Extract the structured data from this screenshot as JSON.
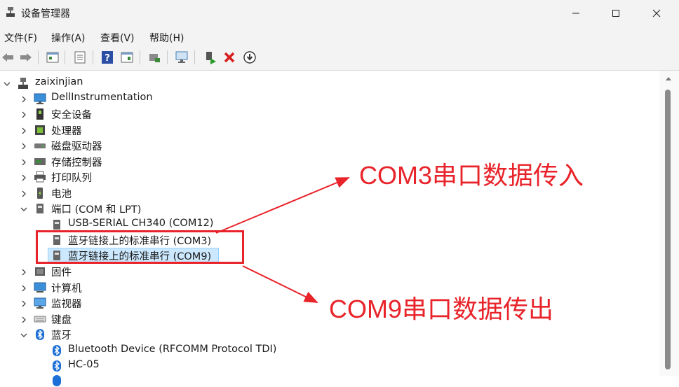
{
  "window": {
    "title": "设备管理器",
    "icon": "device-manager-icon"
  },
  "menu": [
    "文件(F)",
    "操作(A)",
    "查看(V)",
    "帮助(H)"
  ],
  "toolbar": {
    "buttons": [
      "back-arrow-icon",
      "forward-arrow-icon",
      "properties-icon",
      "details-icon",
      "help-icon",
      "view-icon",
      "update-driver-icon",
      "scan-hardware-icon",
      "enable-device-icon",
      "uninstall-icon",
      "download-icon"
    ]
  },
  "tree": {
    "root": "zaixinjian",
    "items": [
      {
        "label": "DellInstrumentation",
        "icon": "monitor-icon",
        "expanded": false
      },
      {
        "label": "安全设备",
        "icon": "security-device-icon",
        "expanded": false
      },
      {
        "label": "处理器",
        "icon": "processor-icon",
        "expanded": false
      },
      {
        "label": "磁盘驱动器",
        "icon": "disk-drive-icon",
        "expanded": false
      },
      {
        "label": "存储控制器",
        "icon": "storage-controller-icon",
        "expanded": false
      },
      {
        "label": "打印队列",
        "icon": "printer-icon",
        "expanded": false
      },
      {
        "label": "电池",
        "icon": "battery-icon",
        "expanded": false
      },
      {
        "label": "端口 (COM 和 LPT)",
        "icon": "port-icon",
        "expanded": true
      },
      {
        "label": "USB-SERIAL CH340 (COM12)",
        "icon": "port-icon",
        "child": true
      },
      {
        "label": "蓝牙链接上的标准串行 (COM3)",
        "icon": "port-icon",
        "child": true
      },
      {
        "label": "蓝牙链接上的标准串行 (COM9)",
        "icon": "port-icon",
        "child": true,
        "selected": true
      },
      {
        "label": "固件",
        "icon": "firmware-icon",
        "expanded": false
      },
      {
        "label": "计算机",
        "icon": "computer-icon",
        "expanded": false
      },
      {
        "label": "监视器",
        "icon": "monitor-icon",
        "expanded": false
      },
      {
        "label": "键盘",
        "icon": "keyboard-icon",
        "expanded": false
      },
      {
        "label": "蓝牙",
        "icon": "bluetooth-icon",
        "expanded": true
      },
      {
        "label": "Bluetooth Device (RFCOMM Protocol TDI)",
        "icon": "bluetooth-icon",
        "child": true
      },
      {
        "label": "HC-05",
        "icon": "bluetooth-icon",
        "child": true
      }
    ]
  },
  "annotations": {
    "in": "COM3串口数据传入",
    "out": "COM9串口数据传出",
    "color": "#e8232a"
  }
}
